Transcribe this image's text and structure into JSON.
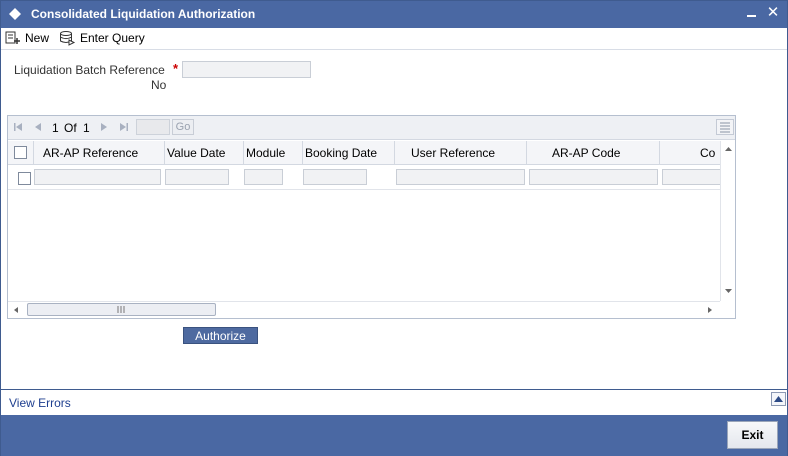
{
  "window": {
    "title": "Consolidated Liquidation Authorization",
    "minimize_glyph": "▬",
    "close_glyph": "✕"
  },
  "toolbar": {
    "new_label": "New",
    "enter_query_label": "Enter Query"
  },
  "form": {
    "batch_ref_label": "Liquidation Batch Reference",
    "batch_ref_label_line2": "No",
    "required_marker": "*",
    "batch_ref_value": ""
  },
  "grid": {
    "pager": {
      "current": "1",
      "of_label": "Of",
      "total": "1",
      "go_label": "Go"
    },
    "columns": [
      "AR-AP Reference",
      "Value Date",
      "Module",
      "Booking Date",
      "User Reference",
      "AR-AP Code",
      "Co"
    ],
    "rows": [
      {
        "checked": false,
        "cells": [
          "",
          "",
          "",
          "",
          "",
          "",
          ""
        ]
      }
    ]
  },
  "actions": {
    "authorize_label": "Authorize",
    "exit_label": "Exit"
  },
  "errors": {
    "view_errors_label": "View Errors"
  },
  "colors": {
    "title_bar": "#4a68a3",
    "button_blue": "#4e6aa0",
    "link": "#1f3f8f"
  }
}
